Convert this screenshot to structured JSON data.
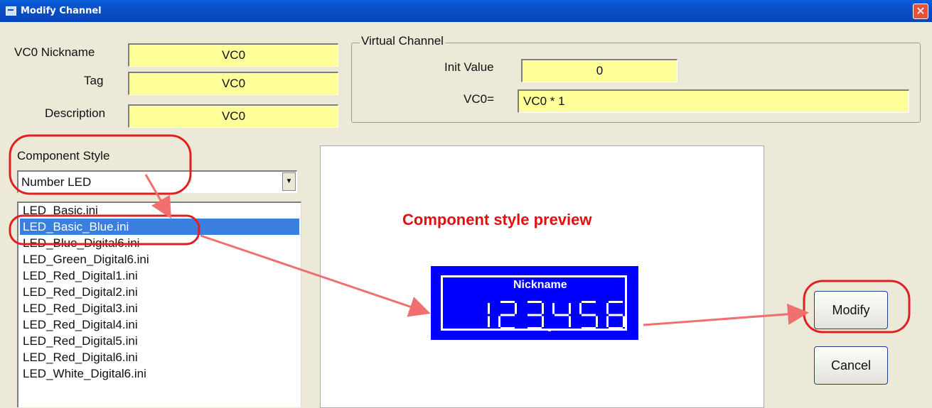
{
  "window": {
    "title": "Modify Channel",
    "close_glyph": "✕"
  },
  "fields": {
    "nickname_label": "VC0 Nickname",
    "nickname_value": "VC0",
    "tag_label": "Tag",
    "tag_value": "VC0",
    "description_label": "Description",
    "description_value": "VC0"
  },
  "virtual_channel": {
    "group_label": "Virtual Channel",
    "init_label": "Init Value",
    "init_value": "0",
    "expr_label": "VC0=",
    "expr_value": "VC0 * 1"
  },
  "component": {
    "label": "Component Style",
    "selected_style": "Number LED",
    "files": [
      "LED_Basic.ini",
      "LED_Basic_Blue.ini",
      "LED_Blue_Digital6.ini",
      "LED_Green_Digital6.ini",
      "LED_Red_Digital1.ini",
      "LED_Red_Digital2.ini",
      "LED_Red_Digital3.ini",
      "LED_Red_Digital4.ini",
      "LED_Red_Digital5.ini",
      "LED_Red_Digital6.ini",
      "LED_White_Digital6.ini"
    ],
    "selected_file": "LED_Basic_Blue.ini"
  },
  "preview": {
    "caption": "Component style preview",
    "led_label": "Nickname",
    "led_value": "123.456"
  },
  "buttons": {
    "modify": "Modify",
    "cancel": "Cancel"
  },
  "colors": {
    "field_bg": "#ffff99",
    "selection": "#3a7ee0",
    "led_bg": "#0000ff",
    "annotation": "#e01010",
    "arrow": "#f07070",
    "highlight_circle": "#e02020"
  }
}
